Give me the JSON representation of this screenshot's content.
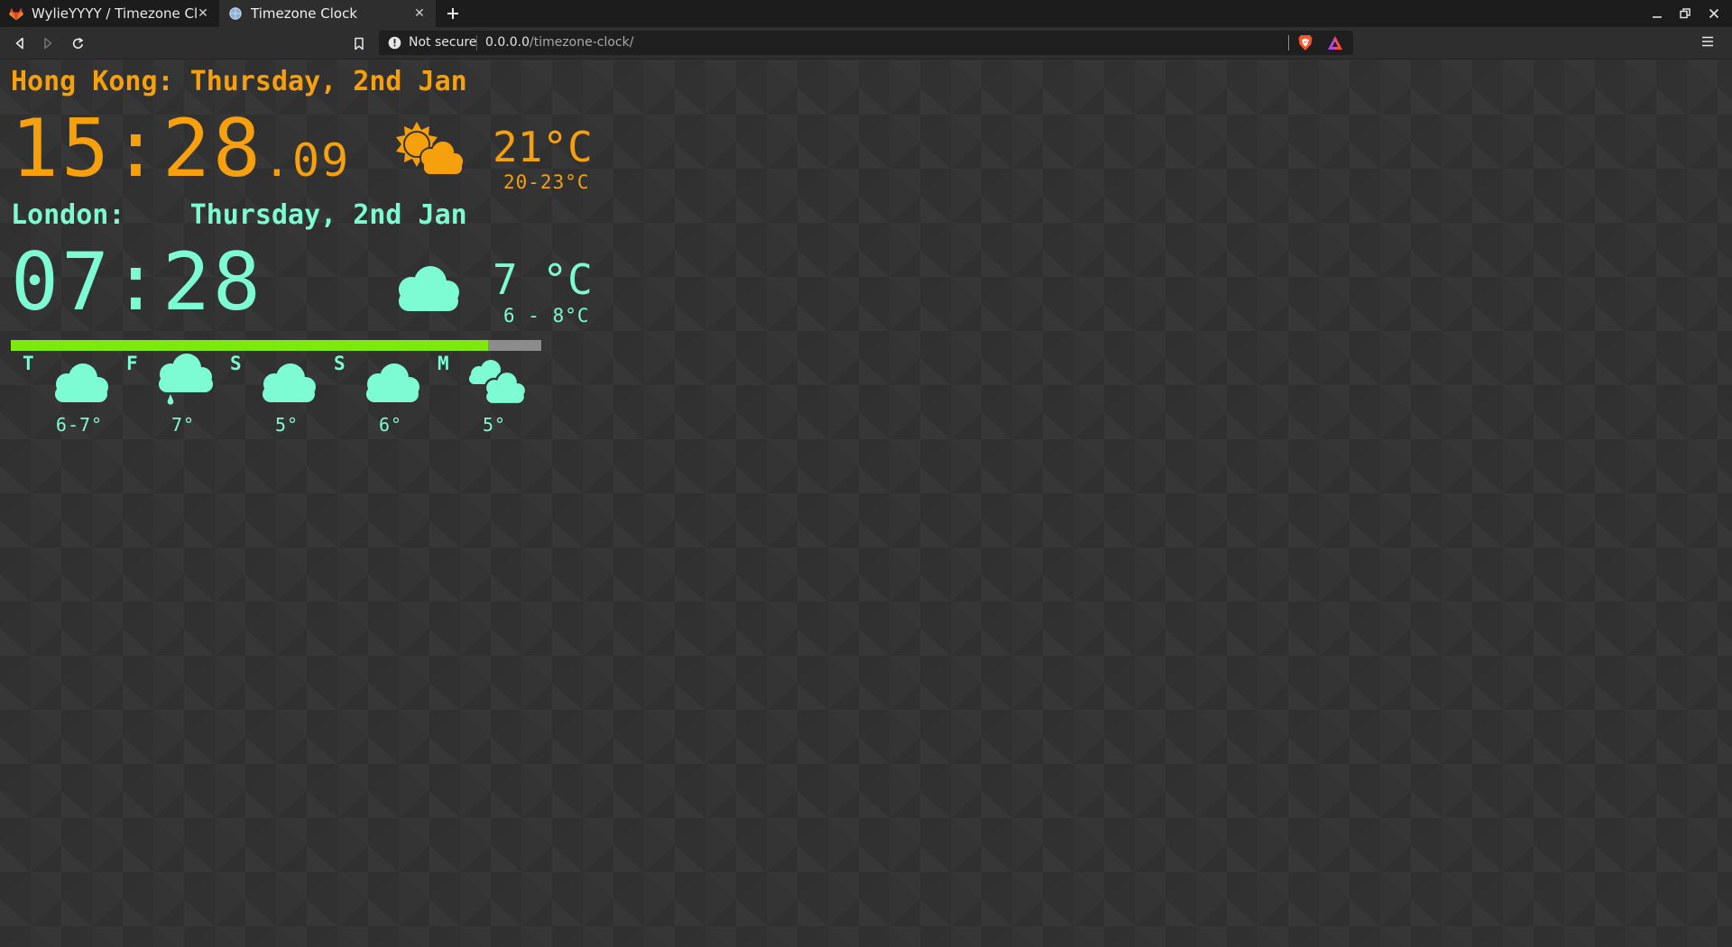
{
  "browser": {
    "tabs": [
      {
        "title": "WylieYYYY / Timezone Clock",
        "active": false,
        "icon": "gitlab-icon"
      },
      {
        "title": "Timezone Clock",
        "active": true,
        "icon": "globe-icon"
      }
    ],
    "address": {
      "security_label": "Not secure",
      "host": "0.0.0.0",
      "path": "/timezone-clock/"
    }
  },
  "colors": {
    "hong_kong": "#f5a00c",
    "london": "#7dfbd2",
    "progress_fill": "#7fe90f",
    "progress_track": "#8c8c8c",
    "background": "#333333"
  },
  "hong_kong": {
    "label": "Hong Kong:",
    "date": "Thursday, 2nd Jan",
    "time_hm": "15:28",
    "time_sec": ".09",
    "weather_icon": "partly-cloudy-sun-icon",
    "temp": "21°C",
    "range": "20-23°C"
  },
  "london": {
    "label": "London:",
    "date": "Thursday, 2nd Jan",
    "time_hm": "07:28",
    "weather_icon": "cloud-icon",
    "temp": "7 °C",
    "range": "6 - 8°C"
  },
  "day_progress": 0.9,
  "forecast": [
    {
      "day": "T",
      "icon": "cloud-icon",
      "temp": "6-7°"
    },
    {
      "day": "F",
      "icon": "cloud-rain-icon",
      "temp": "7°"
    },
    {
      "day": "S",
      "icon": "cloud-icon",
      "temp": "5°"
    },
    {
      "day": "S",
      "icon": "cloud-icon",
      "temp": "6°"
    },
    {
      "day": "M",
      "icon": "two-clouds-icon",
      "temp": "5°"
    }
  ]
}
